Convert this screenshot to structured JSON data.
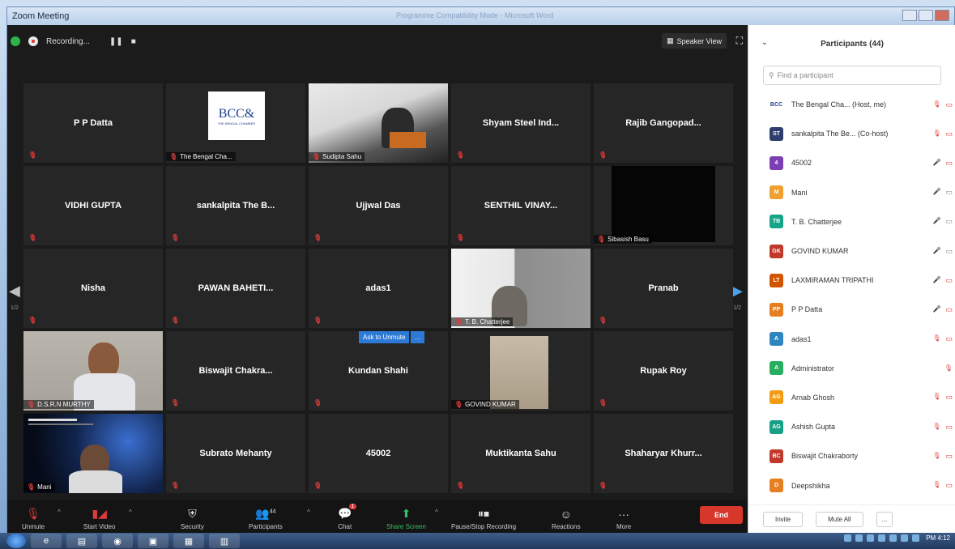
{
  "window": {
    "title": "Zoom Meeting",
    "ghost_title": "Programme Compatibility Mode - Microsoft Word"
  },
  "top_bar": {
    "recording_label": "Recording...",
    "pause": "❚❚",
    "stop": "■",
    "speaker_view": "Speaker View"
  },
  "grid": {
    "tiles": [
      {
        "name": "P P Datta",
        "type": "name"
      },
      {
        "name": "",
        "type": "logo",
        "label": "The Bengal Cha...",
        "logo_text": "BCC&",
        "logo_sub": "THE BENGAL CHAMBER"
      },
      {
        "name": "",
        "type": "video-room",
        "label": "Sudipta Sahu"
      },
      {
        "name": "Shyam Steel Ind...",
        "type": "name"
      },
      {
        "name": "Rajib  Gangopad...",
        "type": "name"
      },
      {
        "name": "VIDHI GUPTA",
        "type": "name"
      },
      {
        "name": "sankalpita The B...",
        "type": "name"
      },
      {
        "name": "Ujjwal Das",
        "type": "name"
      },
      {
        "name": "SENTHIL  VINAY...",
        "type": "name"
      },
      {
        "name": "",
        "type": "black",
        "label": "Sibasish Basu"
      },
      {
        "name": "Nisha",
        "type": "name"
      },
      {
        "name": "PAWAN  BAHETI...",
        "type": "name"
      },
      {
        "name": "adas1",
        "type": "name"
      },
      {
        "name": "",
        "type": "video-office",
        "label": "T. B. Chatterjee"
      },
      {
        "name": "Pranab",
        "type": "name"
      },
      {
        "name": "",
        "type": "video-person",
        "label": "D.S.R.N MURTHY"
      },
      {
        "name": "Biswajit  Chakra...",
        "type": "name"
      },
      {
        "name": "Kundan Shahi",
        "type": "name"
      },
      {
        "name": "",
        "type": "video-wall",
        "label": "GOVIND KUMAR"
      },
      {
        "name": "Rupak Roy",
        "type": "name"
      },
      {
        "name": "",
        "type": "video-slide",
        "label": "Mani"
      },
      {
        "name": "Subrato Mehanty",
        "type": "name"
      },
      {
        "name": "45002",
        "type": "name"
      },
      {
        "name": "Muktikanta Sahu",
        "type": "name"
      },
      {
        "name": "Shaharyar  Khurr...",
        "type": "name"
      }
    ],
    "page_left": "1/2",
    "page_right": "1/2",
    "unmute_popup": {
      "label": "Ask to Unmute",
      "more": "..."
    }
  },
  "toolbar": {
    "unmute": "Unmute",
    "start_video": "Start Video",
    "security": "Security",
    "participants": "Participants",
    "participants_count": "44",
    "chat": "Chat",
    "chat_badge": "1",
    "share_screen": "Share Screen",
    "pause_stop_recording": "Pause/Stop Recording",
    "reactions": "Reactions",
    "more": "More",
    "end": "End"
  },
  "panel": {
    "title": "Participants (44)",
    "search_placeholder": "Find a participant",
    "participants": [
      {
        "initials": "BCC",
        "color": "#ffffff",
        "text_color": "#1f3f8f",
        "name": "The Bengal Cha...  (Host, me)",
        "mic": "muted",
        "cam": "muted"
      },
      {
        "initials": "ST",
        "color": "#2f3e6e",
        "name": "sankalpita The Be...  (Co-host)",
        "mic": "muted",
        "cam": "muted"
      },
      {
        "initials": "4",
        "color": "#7b3fb3",
        "name": "45002",
        "mic": "unmuted",
        "cam": "muted"
      },
      {
        "initials": "M",
        "color": "#f0a030",
        "name": "Mani",
        "mic": "unmuted",
        "cam": "unmuted"
      },
      {
        "initials": "TB",
        "color": "#17a589",
        "name": "T. B. Chatterjee",
        "mic": "unmuted",
        "cam": "unmuted"
      },
      {
        "initials": "GK",
        "color": "#c0392b",
        "name": "GOVIND KUMAR",
        "mic": "unmuted",
        "cam": "unmuted"
      },
      {
        "initials": "LT",
        "color": "#d35400",
        "name": "LAXMIRAMAN TRIPATHI",
        "mic": "unmuted",
        "cam": "muted"
      },
      {
        "initials": "PP",
        "color": "#e67e22",
        "name": "P P Datta",
        "mic": "unmuted",
        "cam": "muted"
      },
      {
        "initials": "A",
        "color": "#2e86c1",
        "name": "adas1",
        "mic": "muted",
        "cam": "muted"
      },
      {
        "initials": "A",
        "color": "#27ae60",
        "name": "Administrator",
        "mic": "muted",
        "cam": "none"
      },
      {
        "initials": "AG",
        "color": "#f39c12",
        "name": "Arnab Ghosh",
        "mic": "muted",
        "cam": "muted"
      },
      {
        "initials": "AG",
        "color": "#16a085",
        "name": "Ashish Gupta",
        "mic": "muted",
        "cam": "muted"
      },
      {
        "initials": "BC",
        "color": "#c0392b",
        "name": "Biswajit Chakraborty",
        "mic": "muted",
        "cam": "muted"
      },
      {
        "initials": "D",
        "color": "#e67e22",
        "name": "Deepshikha",
        "mic": "muted",
        "cam": "muted"
      }
    ],
    "invite": "Invite",
    "mute_all": "Mute All",
    "more": "..."
  },
  "taskbar": {
    "time": "PM 4:12"
  }
}
